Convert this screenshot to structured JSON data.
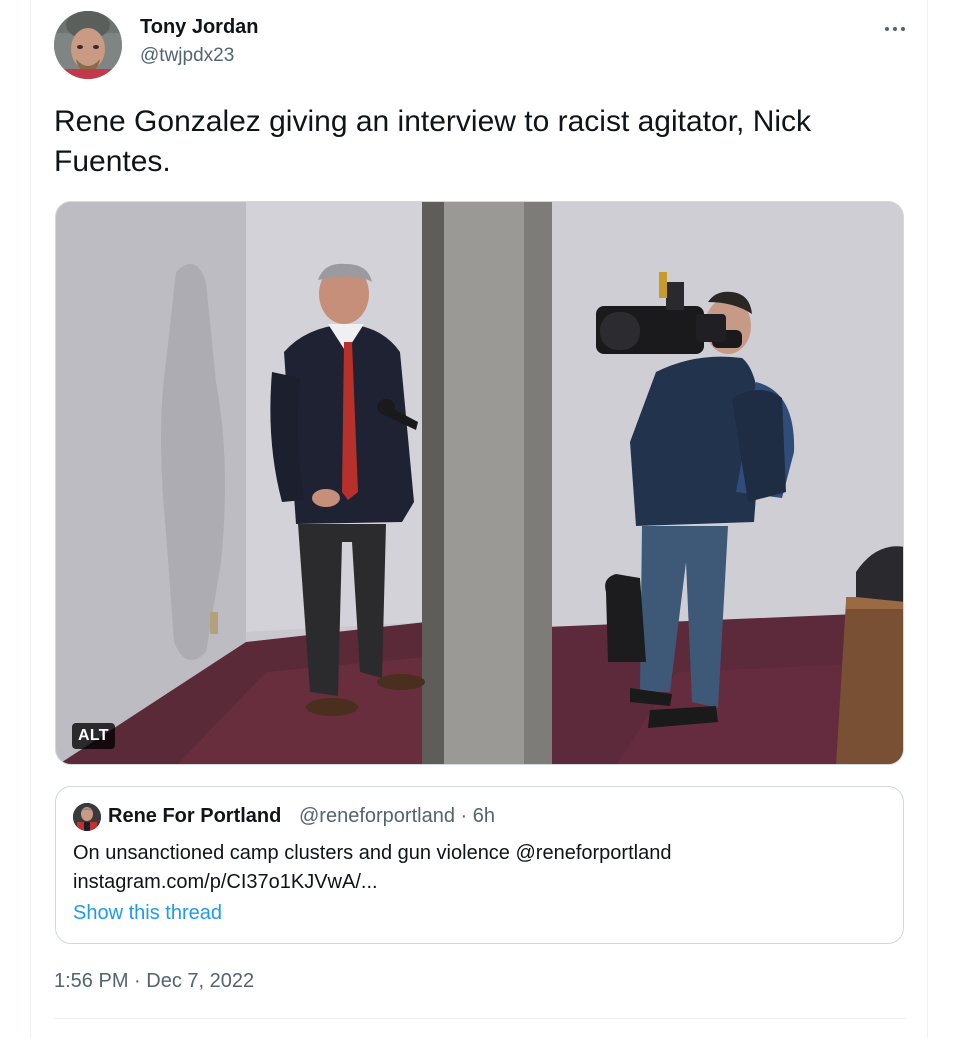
{
  "tweet": {
    "author_name": "Tony Jordan",
    "author_handle": "@twjpdx23",
    "text": "Rene Gonzalez giving an interview to racist agitator, Nick Fuentes.",
    "media_alt_label": "ALT",
    "timestamp": "1:56 PM · Dec 7, 2022",
    "more_icon": "more-horizontal-icon"
  },
  "quoted_tweet": {
    "author_name": "Rene For Portland",
    "author_handle": "@reneforportland",
    "separator": "·",
    "age": "6h",
    "text_line1": "On unsanctioned camp clusters and gun violence @reneforportland",
    "text_line2": "instagram.com/p/CI37o1KJVwA/...",
    "show_thread": "Show this thread"
  },
  "colors": {
    "text_primary": "#0f1419",
    "text_secondary": "#536471",
    "link": "#1d9bf0",
    "border": "#cfd9de"
  }
}
